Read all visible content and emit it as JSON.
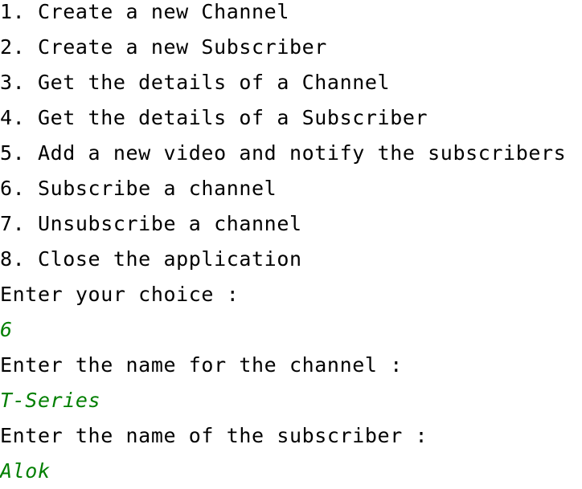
{
  "console": {
    "menu": [
      "1. Create a new Channel",
      "2. Create a new Subscriber",
      "3. Get the details of a Channel",
      "4. Get the details of a Subscriber",
      "5. Add a new video and notify the subscribers",
      "6. Subscribe a channel",
      "7. Unsubscribe a channel",
      "8. Close the application"
    ],
    "prompt_choice": "Enter your choice :",
    "input_choice": "6",
    "prompt_channel": "Enter the name for the channel :",
    "input_channel": "T-Series",
    "prompt_subscriber": "Enter the name of the subscriber :",
    "input_subscriber": "Alok",
    "colors": {
      "output_text": "#000000",
      "user_input": "#007f00",
      "background": "#ffffff"
    }
  }
}
